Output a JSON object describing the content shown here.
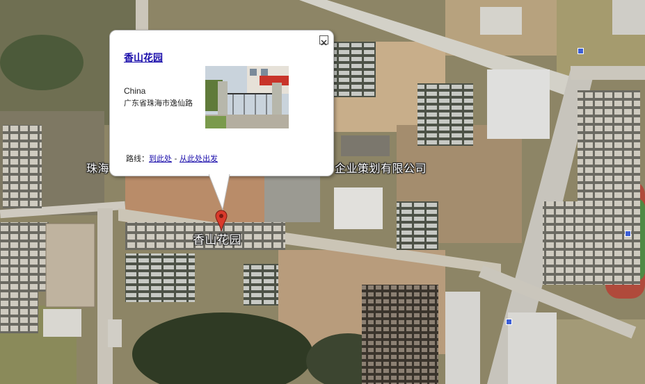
{
  "map": {
    "labels": {
      "left_partial": "珠海",
      "company_partial": "企业策划有限公司",
      "marker": "香山花园"
    },
    "marker": {
      "name": "red-pin",
      "color": "#d93a2b"
    },
    "poi_color": "#3d5fd6"
  },
  "info_window": {
    "title": "香山花园",
    "country": "China",
    "address": "广东省珠海市逸仙路",
    "route_label": "路线：",
    "route_to": "到此处",
    "route_separator": " - ",
    "route_from": "从此处出发",
    "close_icon": "close-x-icon"
  }
}
